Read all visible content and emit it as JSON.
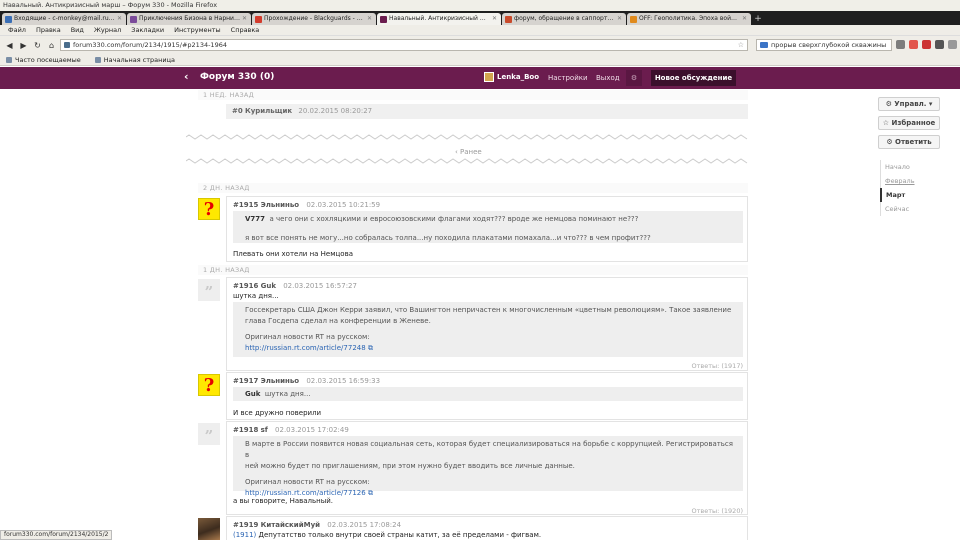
{
  "window": {
    "title": "Навальный. Антикризисный марш – Форум 330 - Mozilla Firefox"
  },
  "tabs": [
    {
      "label": "Входящие - c-monkey@mail.ru - П...",
      "color": "#3b6fb6",
      "active": false
    },
    {
      "label": "Приключения Бизона в Нарнии 1...",
      "color": "#7b4b9a",
      "active": false
    },
    {
      "label": "Прохождение - Blackguards - прох...",
      "color": "#d33b2c",
      "active": false
    },
    {
      "label": "Навальный. Антикризисный мар...",
      "color": "#6b1c4e",
      "active": true
    },
    {
      "label": "форум, обращение в саппорт - Ф...",
      "color": "#c94a2b",
      "active": false
    },
    {
      "label": "OFF: Геополитика. Эпоха войн-2 и...",
      "color": "#e08a1c",
      "active": false
    }
  ],
  "menu": [
    "Файл",
    "Правка",
    "Вид",
    "Журнал",
    "Закладки",
    "Инструменты",
    "Справка"
  ],
  "navbar": {
    "url": "forum330.com/forum/2134/1915/#p2134-1964",
    "search_value": "прорыв сверхглубокой скважины"
  },
  "bookmarks": [
    "Часто посещаемые",
    "Начальная страница"
  ],
  "header": {
    "forum_title": "Форум 330",
    "count": "(0)",
    "username": "Lenka_Boo",
    "settings": "Настройки",
    "logout": "Выход",
    "new_discussion": "Новое обсуждение"
  },
  "feed": {
    "week_ago": "1 НЕД. НАЗАД",
    "pinned": {
      "num": "#0",
      "author": "Курильщик",
      "date": "20.02.2015 08:20:27"
    },
    "earlier": "‹ Ранее",
    "two_days_ago": "2 ДН. НАЗАД",
    "one_day_ago": "1 ДН. НАЗАД",
    "posts": [
      {
        "num": "#1915",
        "author": "Эльниньо",
        "date": "02.03.2015 10:21:59",
        "quote_author": "V777",
        "quote_line1": "а чего они с хохляцкими и евросоюзовскими флагами ходят??? вроде же немцова поминают не???",
        "quote_line2": "я вот все понять не могу...но собралась толпа...ну походила плакатами помахала...и что??? в чем профит???",
        "text": "Плевать они хотели на Немцова"
      },
      {
        "num": "#1916",
        "author": "Guk",
        "date": "02.03.2015 16:57:27",
        "intro": "шутка дня...",
        "quote_line1": "Госсекретарь США Джон Керри заявил, что Вашингтон непричастен к многочисленным «цветным революциям». Такое заявление",
        "quote_line2": "глава Госдепа сделал на конференции в Женеве.",
        "source_label": "Оригинал новости RT на русском:",
        "source_link": "http://russian.rt.com/article/77248",
        "replies": "Ответы: (1917)"
      },
      {
        "num": "#1917",
        "author": "Эльниньо",
        "date": "02.03.2015 16:59:33",
        "quote_author": "Guk",
        "quote_text": "шутка дня...",
        "text": "И все дружно поверили"
      },
      {
        "num": "#1918",
        "author": "sf",
        "date": "02.03.2015 17:02:49",
        "quote_line1": "В марте в России появится новая социальная сеть, которая будет специализироваться на борьбе с коррупцией. Регистрироваться в",
        "quote_line2": "ней можно будет по приглашениям, при этом нужно будет вводить все личные данные.",
        "source_label": "Оригинал новости RT на русском:",
        "source_link": "http://russian.rt.com/article/77126",
        "text": "а вы говорите, Навальный.",
        "replies": "Ответы: (1920)"
      },
      {
        "num": "#1919",
        "author": "КитайскийМуй",
        "date": "02.03.2015 17:08:24",
        "reply_ref": "(1911)",
        "text": "Депутатство только внутри своей страны катит, за её пределами - фигвам."
      }
    ]
  },
  "sidebar": {
    "manage": "Управл.",
    "favorites": "Избранное",
    "reply": "Ответить",
    "timeline": [
      "Начало",
      "Февраль",
      "Март",
      "Сейчас"
    ]
  },
  "status": {
    "url": "forum330.com/forum/2134/2015/2"
  }
}
